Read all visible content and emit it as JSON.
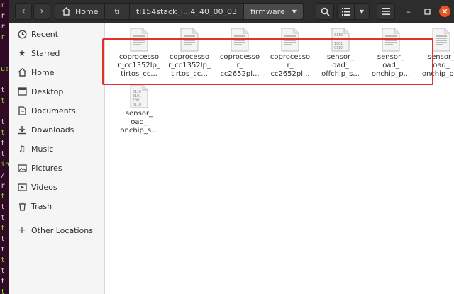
{
  "terminal_strip": {
    "glyphs": [
      "r",
      "r",
      "r",
      "r",
      "",
      "",
      "u:",
      "",
      "t",
      "t",
      "",
      "t",
      "t",
      "t",
      "t",
      "in",
      "/",
      "r",
      "t",
      "t",
      "t",
      "t",
      "t",
      "t",
      "t",
      "t",
      "t",
      "t"
    ]
  },
  "headerbar": {
    "back_glyph": "‹",
    "forward_glyph": "›",
    "breadcrumbs": [
      {
        "label": "Home",
        "icon": "home-icon"
      },
      {
        "label": "ti"
      },
      {
        "label": "ti154stack_l...4_40_00_03"
      },
      {
        "label": "firmware",
        "dropdown": true
      }
    ]
  },
  "sidebar": {
    "items": [
      {
        "label": "Recent",
        "icon": "recent-clock-icon"
      },
      {
        "label": "Starred",
        "icon": "star-icon"
      },
      {
        "label": "Home",
        "icon": "home-icon"
      },
      {
        "label": "Desktop",
        "icon": "desktop-icon"
      },
      {
        "label": "Documents",
        "icon": "documents-icon"
      },
      {
        "label": "Downloads",
        "icon": "downloads-icon"
      },
      {
        "label": "Music",
        "icon": "music-icon"
      },
      {
        "label": "Pictures",
        "icon": "pictures-icon"
      },
      {
        "label": "Videos",
        "icon": "videos-icon"
      },
      {
        "label": "Trash",
        "icon": "trash-icon"
      }
    ],
    "other_locations": {
      "label": "Other Locations",
      "icon": "plus-icon"
    }
  },
  "files": [
    {
      "name": "coprocesso\nr_cc1352lp_\ntirtos_cc...",
      "type": "text"
    },
    {
      "name": "coprocesso\nr_cc1352lp_\ntirtos_cc...",
      "type": "text"
    },
    {
      "name": "coprocesso\nr_\ncc2652pl...",
      "type": "text"
    },
    {
      "name": "coprocesso\nr_\ncc2652pl...",
      "type": "text"
    },
    {
      "name": "sensor_\noad_\noffchip_s...",
      "type": "binary"
    },
    {
      "name": "sensor_\noad_\nonchip_p...",
      "type": "text"
    },
    {
      "name": "sensor_\noad_\nonchip_p...",
      "type": "text"
    },
    {
      "name": "sensor_\noad_\nonchip_s...",
      "type": "binary"
    }
  ],
  "colors": {
    "accent_close": "#e95420",
    "highlight_box": "#e03030",
    "headerbar": "#2d2d2d"
  }
}
